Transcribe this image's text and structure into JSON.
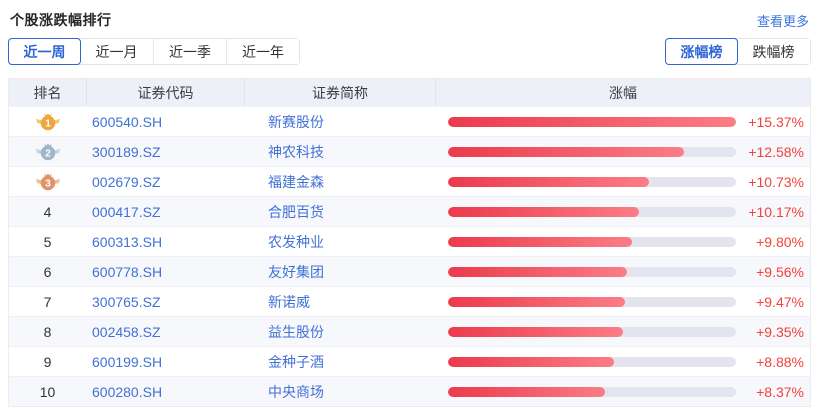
{
  "header": {
    "title": "个股涨跌幅排行",
    "more_link": "查看更多"
  },
  "period_tabs": [
    {
      "label": "近一周",
      "active": true
    },
    {
      "label": "近一月",
      "active": false
    },
    {
      "label": "近一季",
      "active": false
    },
    {
      "label": "近一年",
      "active": false
    }
  ],
  "board_tabs": [
    {
      "label": "涨幅榜",
      "active": true
    },
    {
      "label": "跌幅榜",
      "active": false
    }
  ],
  "table": {
    "columns": [
      "排名",
      "证券代码",
      "证券简称",
      "涨幅"
    ],
    "max_value": 15.37,
    "rows": [
      {
        "rank": "1",
        "medal": "gold",
        "code": "600540.SH",
        "name": "新赛股份",
        "change": "+15.37%",
        "value": 15.37
      },
      {
        "rank": "2",
        "medal": "silver",
        "code": "300189.SZ",
        "name": "神农科技",
        "change": "+12.58%",
        "value": 12.58
      },
      {
        "rank": "3",
        "medal": "bronze",
        "code": "002679.SZ",
        "name": "福建金森",
        "change": "+10.73%",
        "value": 10.73
      },
      {
        "rank": "4",
        "medal": null,
        "code": "000417.SZ",
        "name": "合肥百货",
        "change": "+10.17%",
        "value": 10.17
      },
      {
        "rank": "5",
        "medal": null,
        "code": "600313.SH",
        "name": "农发种业",
        "change": "+9.80%",
        "value": 9.8
      },
      {
        "rank": "6",
        "medal": null,
        "code": "600778.SH",
        "name": "友好集团",
        "change": "+9.56%",
        "value": 9.56
      },
      {
        "rank": "7",
        "medal": null,
        "code": "300765.SZ",
        "name": "新诺威",
        "change": "+9.47%",
        "value": 9.47
      },
      {
        "rank": "8",
        "medal": null,
        "code": "002458.SZ",
        "name": "益生股份",
        "change": "+9.35%",
        "value": 9.35
      },
      {
        "rank": "9",
        "medal": null,
        "code": "600199.SH",
        "name": "金种子酒",
        "change": "+8.88%",
        "value": 8.88
      },
      {
        "rank": "10",
        "medal": null,
        "code": "600280.SH",
        "name": "中央商场",
        "change": "+8.37%",
        "value": 8.37
      }
    ]
  },
  "colors": {
    "accent_blue": "#2f66d4",
    "link_blue": "#3a78dd",
    "bar_gradient_start": "#ec3a4d",
    "bar_gradient_end": "#fb7d85",
    "bar_track": "#e4e4ef",
    "change_text": "#f4413a",
    "medal_gold": "#efa63c",
    "medal_gold_wing": "#f6c873",
    "medal_silver": "#9fb5c9",
    "medal_silver_wing": "#c6d4e0",
    "medal_bronze": "#e2936a",
    "medal_bronze_wing": "#f0bb99"
  }
}
